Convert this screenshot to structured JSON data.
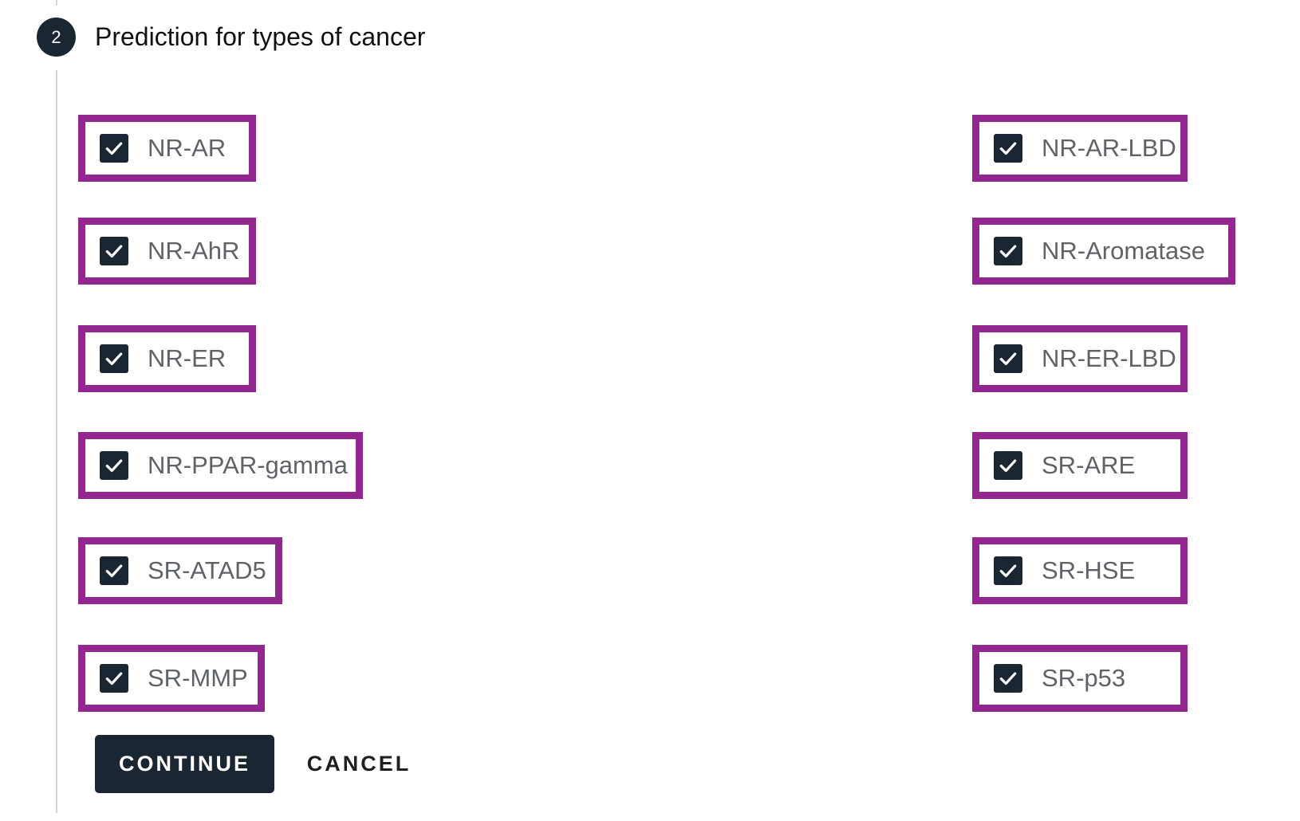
{
  "step": {
    "number": "2",
    "title": "Prediction for types of cancer"
  },
  "options": {
    "left": [
      {
        "label": "NR-AR",
        "checked": true
      },
      {
        "label": "NR-AhR",
        "checked": true
      },
      {
        "label": "NR-ER",
        "checked": true
      },
      {
        "label": "NR-PPAR-gamma",
        "checked": true
      },
      {
        "label": "SR-ATAD5",
        "checked": true
      },
      {
        "label": "SR-MMP",
        "checked": true
      }
    ],
    "right": [
      {
        "label": "NR-AR-LBD",
        "checked": true
      },
      {
        "label": "NR-Aromatase",
        "checked": true
      },
      {
        "label": "NR-ER-LBD",
        "checked": true
      },
      {
        "label": "SR-ARE",
        "checked": true
      },
      {
        "label": "SR-HSE",
        "checked": true
      },
      {
        "label": "SR-p53",
        "checked": true
      }
    ]
  },
  "actions": {
    "continue_label": "CONTINUE",
    "cancel_label": "CANCEL"
  },
  "colors": {
    "highlight_border": "#93278f",
    "primary": "#1b2633",
    "label_text": "#5f6368"
  },
  "icons": {
    "checked": "checkmark-icon"
  }
}
